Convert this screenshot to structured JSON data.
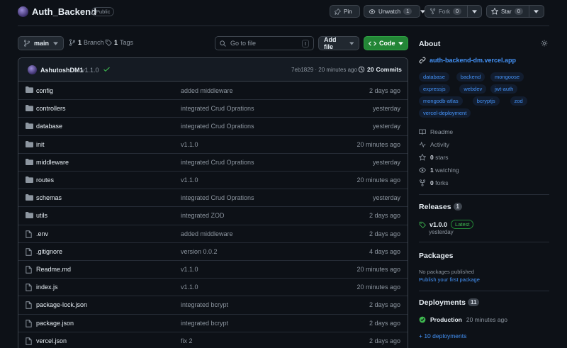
{
  "repo": {
    "name": "Auth_Backend",
    "visibility": "Public"
  },
  "header_buttons": {
    "pin_label": "Pin",
    "unwatch_label": "Unwatch",
    "unwatch_count": "1",
    "fork_label": "Fork",
    "fork_count": "0",
    "star_label": "Star",
    "star_count": "0"
  },
  "toolbar": {
    "branch": "main",
    "branches_count": "1",
    "branches_label": "Branch",
    "tags_count": "1",
    "tags_label": "Tags",
    "goto_placeholder": "Go to file",
    "goto_kbd": "t",
    "add_file_label": "Add file",
    "code_label": "Code"
  },
  "latest_commit": {
    "author": "AshutoshDM1",
    "message": "v1.1.0",
    "hash_time": "7eb1829 · 20 minutes ago",
    "commits_count": "20",
    "commits_label": "Commits"
  },
  "files": [
    {
      "name": "config",
      "type": "folder",
      "message": "added middleware",
      "date": "2 days ago"
    },
    {
      "name": "controllers",
      "type": "folder",
      "message": "integrated Crud Oprations",
      "date": "yesterday"
    },
    {
      "name": "database",
      "type": "folder",
      "message": "integrated Crud Oprations",
      "date": "yesterday"
    },
    {
      "name": "init",
      "type": "folder",
      "message": "v1.1.0",
      "date": "20 minutes ago"
    },
    {
      "name": "middleware",
      "type": "folder",
      "message": "integrated Crud Oprations",
      "date": "yesterday"
    },
    {
      "name": "routes",
      "type": "folder",
      "message": "v1.1.0",
      "date": "20 minutes ago"
    },
    {
      "name": "schemas",
      "type": "folder",
      "message": "integrated Crud Oprations",
      "date": "yesterday"
    },
    {
      "name": "utils",
      "type": "folder",
      "message": "integrated ZOD",
      "date": "2 days ago"
    },
    {
      "name": ".env",
      "type": "file",
      "message": "added middleware",
      "date": "2 days ago"
    },
    {
      "name": ".gitignore",
      "type": "file",
      "message": "version 0.0.2",
      "date": "4 days ago"
    },
    {
      "name": "Readme.md",
      "type": "file",
      "message": "v1.1.0",
      "date": "20 minutes ago"
    },
    {
      "name": "index.js",
      "type": "file",
      "message": "v1.1.0",
      "date": "20 minutes ago"
    },
    {
      "name": "package-lock.json",
      "type": "file",
      "message": "integrated bcrypt",
      "date": "2 days ago"
    },
    {
      "name": "package.json",
      "type": "file",
      "message": "integrated bcrypt",
      "date": "2 days ago"
    },
    {
      "name": "vercel.json",
      "type": "file",
      "message": "fix 2",
      "date": "2 days ago"
    }
  ],
  "about": {
    "title": "About",
    "website": "auth-backend-dm.vercel.app",
    "topics": [
      "database",
      "backend",
      "mongoose",
      "expressjs",
      "webdev",
      "jwt-auth",
      "mongodb-atlas",
      "bcryptjs",
      "zod",
      "vercel-deployment"
    ],
    "readme_label": "Readme",
    "activity_label": "Activity",
    "stars_count": "0",
    "stars_label": "stars",
    "watching_count": "1",
    "watching_label": "watching",
    "forks_count": "0",
    "forks_label": "forks"
  },
  "releases": {
    "title": "Releases",
    "count": "1",
    "tag": "v1.0.0",
    "badge": "Latest",
    "time": "yesterday"
  },
  "packages": {
    "title": "Packages",
    "empty_text": "No packages published",
    "publish_link": "Publish your first package"
  },
  "deployments": {
    "title": "Deployments",
    "count": "11",
    "env": "Production",
    "time": "20 minutes ago",
    "more_link": "+ 10 deployments"
  },
  "icons": {
    "folder": "folder-icon",
    "file": "file-icon",
    "branch": "git-branch-icon",
    "tag": "tag-icon",
    "search": "search-icon",
    "link": "link-icon",
    "gear": "gear-icon"
  },
  "colors": {
    "accent": "#4493f8",
    "primary_button": "#238636",
    "success": "#3fb950"
  }
}
